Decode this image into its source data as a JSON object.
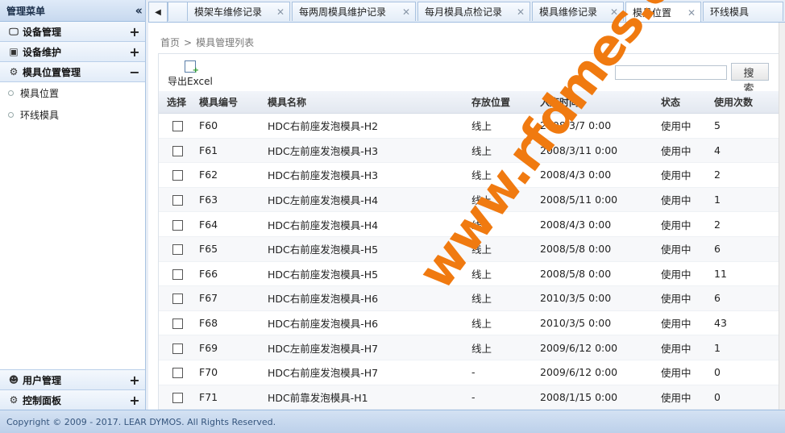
{
  "sidebar": {
    "title": "管理菜单",
    "collapse_icon": "double-chevron-left-icon",
    "sections": [
      {
        "label": "设备管理",
        "icon": "monitor-icon",
        "toggle": "+"
      },
      {
        "label": "设备维护",
        "icon": "wrench-icon",
        "toggle": "+"
      },
      {
        "label": "模具位置管理",
        "icon": "gear-icon",
        "toggle": "−"
      }
    ],
    "sub_items": [
      {
        "label": "模具位置"
      },
      {
        "label": "环线模具"
      }
    ],
    "bottom_sections": [
      {
        "label": "用户管理",
        "icon": "users-icon",
        "toggle": "+"
      },
      {
        "label": "控制面板",
        "icon": "settings-icon",
        "toggle": "+"
      }
    ]
  },
  "tabs": [
    {
      "label": "",
      "active": false
    },
    {
      "label": "模架车维修记录",
      "active": false
    },
    {
      "label": "每两周模具维护记录",
      "active": false
    },
    {
      "label": "每月模具点检记录",
      "active": false
    },
    {
      "label": "模具维修记录",
      "active": false
    },
    {
      "label": "模具位置",
      "active": true
    },
    {
      "label": "环线模具",
      "active": false
    }
  ],
  "breadcrumb": {
    "home": "首页",
    "separator": ">",
    "current": "模具管理列表"
  },
  "toolbar": {
    "export_label": "导出Excel",
    "search_placeholder": "",
    "search_label": "搜 索"
  },
  "table": {
    "headers": [
      "选择",
      "模具编号",
      "模具名称",
      "存放位置",
      "入库时间",
      "状态",
      "使用次数"
    ],
    "rows": [
      {
        "id": "F60",
        "name": "HDC右前座发泡模具-H2",
        "loc": "线上",
        "time": "2008/3/7 0:00",
        "status": "使用中",
        "count": "5"
      },
      {
        "id": "F61",
        "name": "HDC左前座发泡模具-H3",
        "loc": "线上",
        "time": "2008/3/11 0:00",
        "status": "使用中",
        "count": "4"
      },
      {
        "id": "F62",
        "name": "HDC右前座发泡模具-H3",
        "loc": "线上",
        "time": "2008/4/3 0:00",
        "status": "使用中",
        "count": "2"
      },
      {
        "id": "F63",
        "name": "HDC左前座发泡模具-H4",
        "loc": "线上",
        "time": "2008/5/11 0:00",
        "status": "使用中",
        "count": "1"
      },
      {
        "id": "F64",
        "name": "HDC右前座发泡模具-H4",
        "loc": "线上",
        "time": "2008/4/3 0:00",
        "status": "使用中",
        "count": "2"
      },
      {
        "id": "F65",
        "name": "HDC右前座发泡模具-H5",
        "loc": "线上",
        "time": "2008/5/8 0:00",
        "status": "使用中",
        "count": "6"
      },
      {
        "id": "F66",
        "name": "HDC右前座发泡模具-H5",
        "loc": "线上",
        "time": "2008/5/8 0:00",
        "status": "使用中",
        "count": "11"
      },
      {
        "id": "F67",
        "name": "HDC右前座发泡模具-H6",
        "loc": "线上",
        "time": "2010/3/5 0:00",
        "status": "使用中",
        "count": "6"
      },
      {
        "id": "F68",
        "name": "HDC右前座发泡模具-H6",
        "loc": "线上",
        "time": "2010/3/5 0:00",
        "status": "使用中",
        "count": "43"
      },
      {
        "id": "F69",
        "name": "HDC左前座发泡模具-H7",
        "loc": "线上",
        "time": "2009/6/12 0:00",
        "status": "使用中",
        "count": "1"
      },
      {
        "id": "F70",
        "name": "HDC右前座发泡模具-H7",
        "loc": "-",
        "time": "2009/6/12 0:00",
        "status": "使用中",
        "count": "0"
      },
      {
        "id": "F71",
        "name": "HDC前靠发泡模具-H1",
        "loc": "-",
        "time": "2008/1/15 0:00",
        "status": "使用中",
        "count": "0"
      }
    ]
  },
  "watermark": "www.rfdmes.com",
  "footer": {
    "copyright": "Copyright © 2009 - 2017. LEAR DYMOS. All Rights Reserved."
  }
}
